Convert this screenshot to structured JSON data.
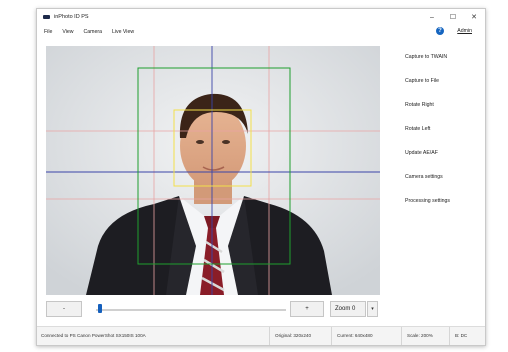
{
  "window": {
    "title": "inPhoto ID PS"
  },
  "window_controls": {
    "minimize": "–",
    "maximize": "☐",
    "close": "✕"
  },
  "menu": [
    "File",
    "View",
    "Camera",
    "Live View"
  ],
  "header": {
    "help": "?",
    "admin": "Admin"
  },
  "side_buttons": [
    "Capture to TWAIN",
    "Capture to File",
    "Rotate Right",
    "Rotate Left",
    "Update AE/AF",
    "Camera settings",
    "Processing settings"
  ],
  "controls": {
    "minus": "-",
    "plus": "+",
    "zoom": "Zoom 0",
    "zoom_arrow": "▾",
    "slider_level": 0.02
  },
  "status": {
    "connection": "Connected to PS Canon PowerShot SX150IS 100A",
    "original": "Original: 320x240",
    "current": "Current: 640x480",
    "scale": "Scale: 200%",
    "extra": "B: DC"
  },
  "colors": {
    "accent": "#1565c0",
    "frame_green": "#1e9e2e",
    "guide_blue": "#3a44a8",
    "guide_red": "#e8a3a3",
    "face_yellow": "#f3e04a"
  },
  "icons": {
    "app": "camera-app-icon",
    "help": "help-icon",
    "zoom_dropdown": "chevron-down-icon"
  }
}
